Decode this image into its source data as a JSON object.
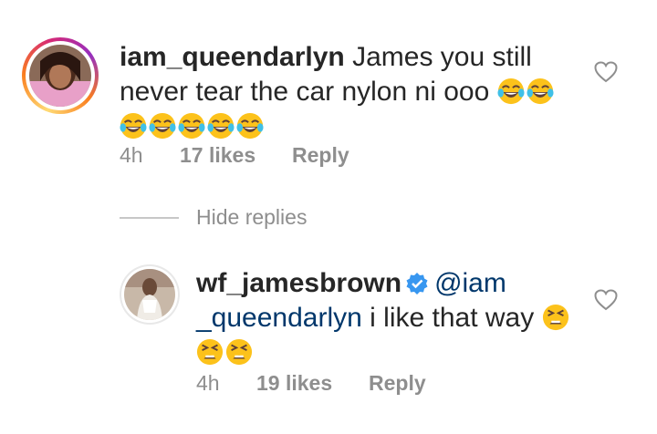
{
  "comment1": {
    "username": "iam_queendarlyn",
    "text": "James you still never tear the car nylon ni ooo",
    "emoji": "face-with-tears-of-joy",
    "emoji_count": 7,
    "time": "4h",
    "likes": "17 likes",
    "reply": "Reply"
  },
  "hide_replies": "Hide replies",
  "reply1": {
    "username": "wf_jamesbrown",
    "verified": true,
    "mention_part1": "@iam",
    "mention_part2": "_queendarlyn",
    "text": " i like that way",
    "emoji": "tired-face",
    "emoji_count": 3,
    "time": "4h",
    "likes": "19 likes",
    "reply": "Reply"
  },
  "colors": {
    "text": "#262626",
    "secondary": "#8e8e8e",
    "mention": "#00376b",
    "verified": "#3897f0",
    "emoji_face": "#fcc21b"
  }
}
